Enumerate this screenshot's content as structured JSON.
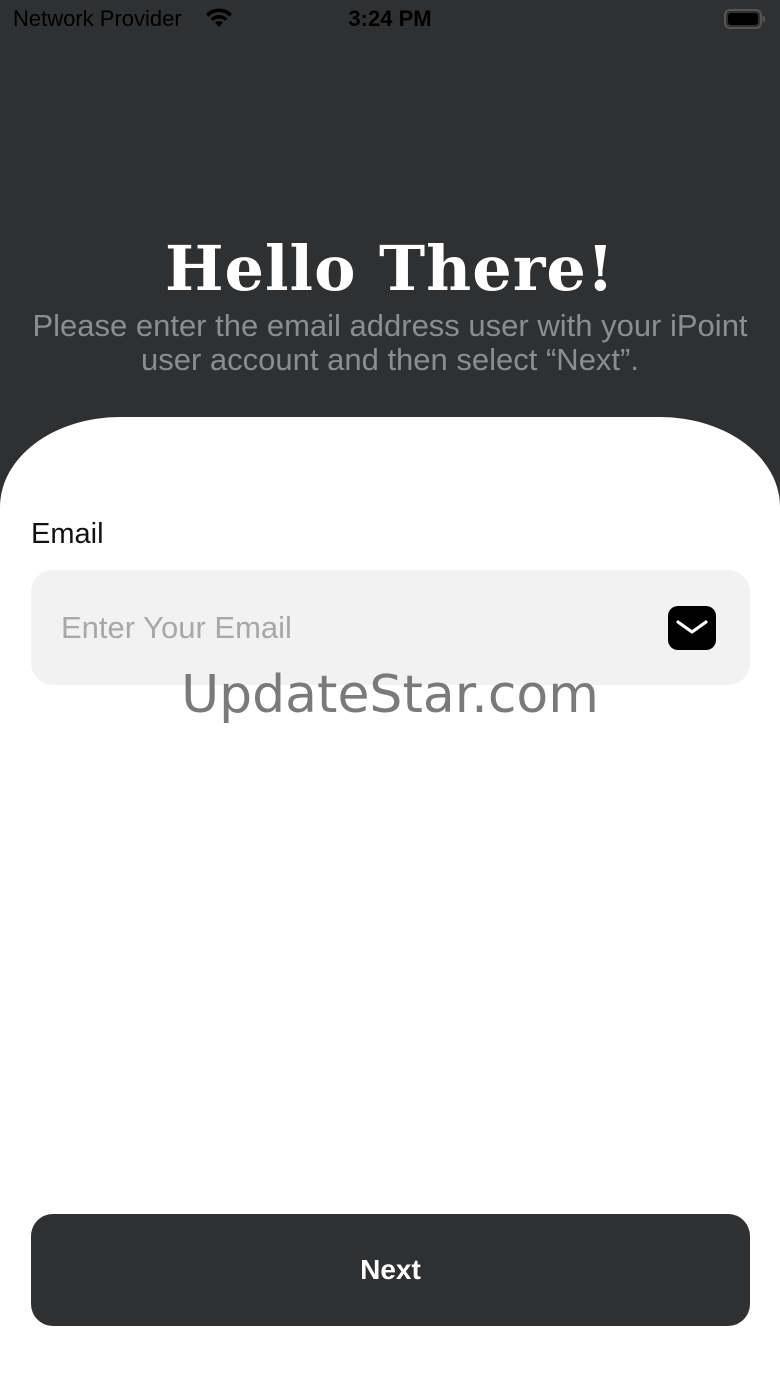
{
  "status_bar": {
    "carrier": "Network Provider",
    "time": "3:24 PM",
    "wifi_icon": "wifi-icon",
    "battery_icon": "battery-icon"
  },
  "header": {
    "title": "Hello There!",
    "subtitle": "Please enter the email address user with your iPoint user account and then select “Next”."
  },
  "form": {
    "email_label": "Email",
    "email_placeholder": "Enter Your Email",
    "email_value": "",
    "email_icon": "mail-icon"
  },
  "watermark": "UpdateStar.com",
  "actions": {
    "next_label": "Next"
  },
  "colors": {
    "background_dark": "#2e3032",
    "sheet": "#ffffff",
    "field_bg": "#f2f2f2",
    "subtitle": "#8b8d8f",
    "placeholder": "#a8a8a8"
  }
}
